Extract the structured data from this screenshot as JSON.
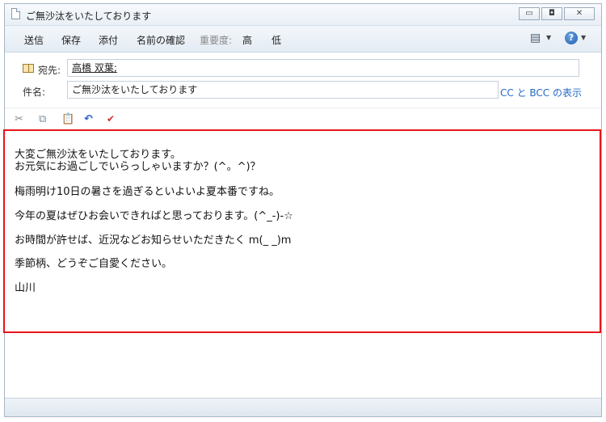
{
  "window": {
    "title": "ご無沙汰をいたしております",
    "controls": {
      "minimize": "▭",
      "restore": "◘",
      "close": "✕"
    }
  },
  "toolbar": {
    "send": "送信",
    "save": "保存",
    "attach": "添付",
    "check_names": "名前の確認",
    "importance_label": "重要度:",
    "importance_high": "高",
    "importance_low": "低",
    "view_icon": "format-icon",
    "help_icon": "help-icon"
  },
  "header": {
    "to_label": "宛先:",
    "to_value": "高橋 双葉;",
    "subject_label": "件名:",
    "subject_value": "ご無沙汰をいたしております",
    "cc_bcc_link": "CC と BCC の表示"
  },
  "format_toolbar": {
    "icons": [
      "cut-icon",
      "copy-icon",
      "paste-icon",
      "undo-icon",
      "spellcheck-icon"
    ]
  },
  "message": {
    "lines": [
      "大変ご無沙汰をいたしております。",
      "お元気にお過ごしでいらっしゃいますか？(^。^)？",
      "梅雨明け10日の暑さを過ぎるといよいよ夏本番ですね。",
      "今年の夏はぜひお会いできればと思っております。(^_-)-☆",
      "お時間が許せば、近況などお知らせいただきたく m(_ _)m",
      "季節柄、どうぞご自愛ください。",
      "山川"
    ]
  },
  "colors": {
    "highlight_border": "#e8141b",
    "link": "#2469c4"
  }
}
